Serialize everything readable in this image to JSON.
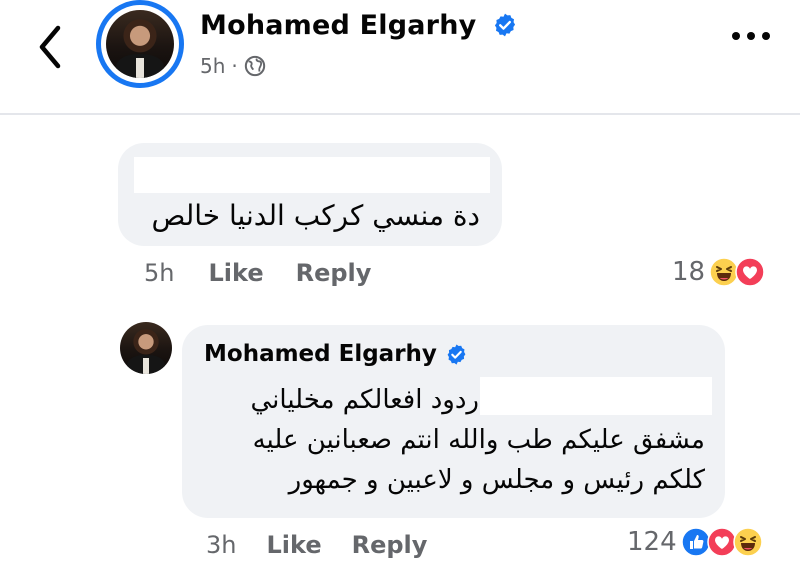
{
  "post_header": {
    "author_name": "Mohamed Elgarhy",
    "time": "5h",
    "separator": "·",
    "icons": {
      "back": "chevron-left-icon",
      "verified": "verified-badge-icon",
      "audience": "globe-icon",
      "more": "more-options-icon"
    },
    "accent_color": "#1877f2"
  },
  "comment": {
    "text": "دة منسي كركب الدنيا خالص",
    "time": "5h",
    "like_label": "Like",
    "reply_label": "Reply",
    "reaction_count": "18",
    "reactions": [
      "haha-reaction-icon",
      "love-reaction-icon"
    ]
  },
  "reply": {
    "author_name": "Mohamed Elgarhy",
    "lines": [
      "ردود افعالكم مخلياني",
      "مشفق عليكم طب والله انتم صعبانين عليه",
      "كلكم  رئيس و مجلس و لاعبين و جمهور"
    ],
    "time": "3h",
    "like_label": "Like",
    "reply_label": "Reply",
    "reaction_count": "124",
    "reactions": [
      "like-reaction-icon",
      "love-reaction-icon",
      "haha-reaction-icon"
    ]
  }
}
